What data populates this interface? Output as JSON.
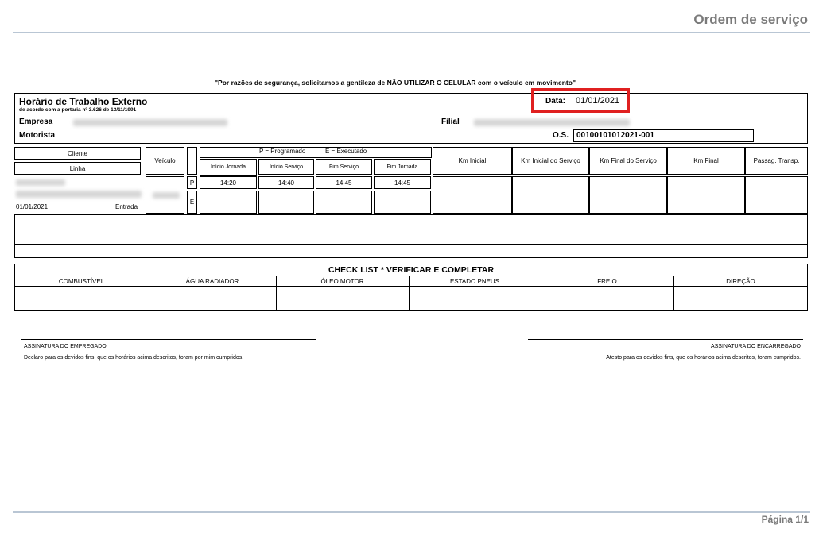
{
  "header": {
    "title": "Ordem de serviço"
  },
  "notice": "\"Por razões de segurança, solicitamos a gentileza de NÃO UTILIZAR O CELULAR com o veículo em movimento\"",
  "info": {
    "heading": "Horário de Trabalho Externo",
    "subheading": "de acordo com a portaria nº 3.626 de 13/11/1991",
    "date_label": "Data:",
    "date_value": "01/01/2021",
    "empresa_label": "Empresa",
    "filial_label": "Filial",
    "motorista_label": "Motorista",
    "os_label": "O.S.",
    "os_value": "00100101012021-001",
    "highlight_color": "#e02020"
  },
  "schedule": {
    "cliente": "Cliente",
    "linha": "Linha",
    "veiculo": "Veículo",
    "legend_p": "P = Programado",
    "legend_e": "E = Executado",
    "col_inicio_jornada": "Início Jornada",
    "col_inicio_servico": "Início Serviço",
    "col_fim_servico": "Fim Serviço",
    "col_fim_jornada": "Fim Jornada",
    "km_inicial": "Km Inicial",
    "km_inicial_servico": "Km Inicial do Serviço",
    "km_final_servico": "Km Final do Serviço",
    "km_final": "Km Final",
    "passag": "Passag. Transp.",
    "row_p": "P",
    "row_e": "E",
    "p_times": [
      "14:20",
      "14:40",
      "14:45",
      "14:45"
    ],
    "row_date": "01/01/2021",
    "row_type": "Entrada"
  },
  "checklist": {
    "title": "CHECK LIST * VERIFICAR E COMPLETAR",
    "columns": [
      "COMBUSTÍVEL",
      "ÁGUA RADIADOR",
      "ÓLEO MOTOR",
      "ESTADO PNEUS",
      "FREIO",
      "DIREÇÃO"
    ]
  },
  "signatures": {
    "employee_label": "ASSINATURA DO EMPREGADO",
    "employee_text": "Declaro para os devidos fins, que os horários acima descritos, foram por mim cumpridos.",
    "supervisor_label": "ASSINATURA DO ENCARREGADO",
    "supervisor_text": "Atesto para os devidos fins, que os horários acima descritos, foram cumpridos."
  },
  "footer": {
    "page": "Página 1/1"
  }
}
